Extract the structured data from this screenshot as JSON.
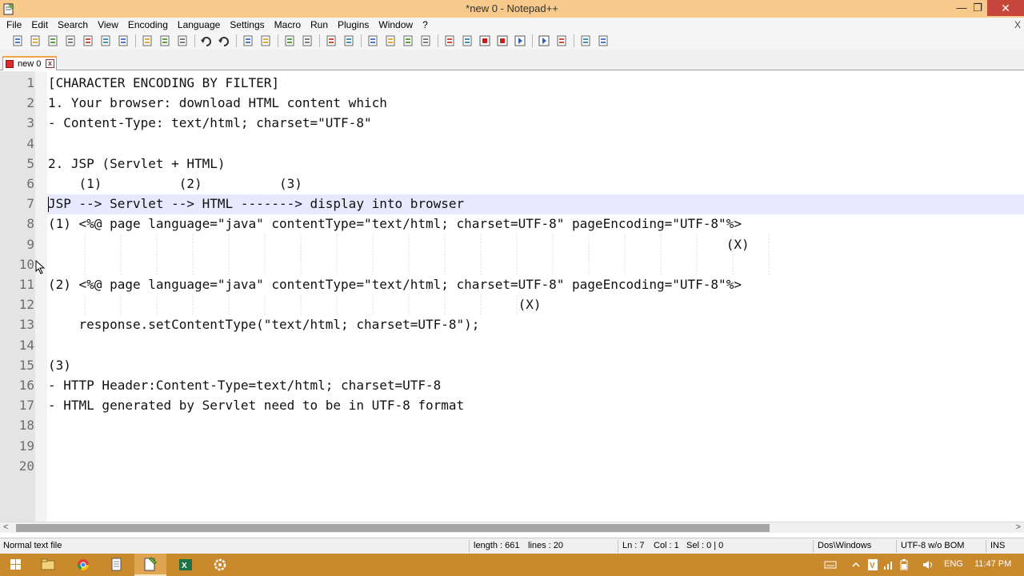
{
  "window": {
    "title": "*new  0 - Notepad++",
    "minimize_icon": "minimize-icon",
    "restore_icon": "restore-icon",
    "close_icon": "close-icon",
    "minimize_glyph": "—",
    "restore_glyph": "❐",
    "close_glyph": "✕"
  },
  "menu": {
    "items": [
      "File",
      "Edit",
      "Search",
      "View",
      "Encoding",
      "Language",
      "Settings",
      "Macro",
      "Run",
      "Plugins",
      "Window",
      "?"
    ],
    "close_glyph": "X"
  },
  "toolbar": {
    "buttons": [
      "new-file-icon",
      "open-file-icon",
      "save-icon",
      "save-all-icon",
      "close-icon",
      "close-all-icon",
      "print-icon",
      "cut-icon",
      "copy-icon",
      "paste-icon",
      "undo-icon",
      "redo-icon",
      "find-icon",
      "replace-icon",
      "zoom-in-icon",
      "zoom-out-icon",
      "sync-vertical-icon",
      "sync-horizontal-icon",
      "word-wrap-icon",
      "show-all-chars-icon",
      "indent-guide-icon",
      "user-language-icon",
      "doc-map-icon",
      "function-list-icon",
      "record-macro-icon",
      "stop-record-icon",
      "play-macro-icon",
      "run-macro-multiple-icon",
      "save-macro-icon",
      "spell-check-icon",
      "spell-check-options-icon"
    ]
  },
  "tabs": [
    {
      "label": "new  0",
      "icon": "unsaved-file-icon"
    }
  ],
  "editor": {
    "current_line": 7,
    "lines": [
      {
        "num": "1",
        "text": "[CHARACTER ENCODING BY FILTER]"
      },
      {
        "num": "2",
        "text": "1. Your browser: download HTML content which"
      },
      {
        "num": "3",
        "text": "- Content-Type: text/html; charset=\"UTF-8\""
      },
      {
        "num": "4",
        "text": ""
      },
      {
        "num": "5",
        "text": "2. JSP (Servlet + HTML)"
      },
      {
        "num": "6",
        "text": "    (1)          (2)          (3)"
      },
      {
        "num": "7",
        "text": "JSP --> Servlet --> HTML -------> display into browser"
      },
      {
        "num": "8",
        "text": "(1) <%@ page language=\"java\" contentType=\"text/html; charset=UTF-8\" pageEncoding=\"UTF-8\"%>"
      },
      {
        "num": "9",
        "text": "                                                                                        (X)"
      },
      {
        "num": "10",
        "text": ""
      },
      {
        "num": "11",
        "text": "(2) <%@ page language=\"java\" contentType=\"text/html; charset=UTF-8\" pageEncoding=\"UTF-8\"%>"
      },
      {
        "num": "12",
        "text": "                                                             (X)"
      },
      {
        "num": "13",
        "text": "    response.setContentType(\"text/html; charset=UTF-8\");"
      },
      {
        "num": "14",
        "text": ""
      },
      {
        "num": "15",
        "text": "(3)"
      },
      {
        "num": "16",
        "text": "- HTTP Header:Content-Type=text/html; charset=UTF-8"
      },
      {
        "num": "17",
        "text": "- HTML generated by Servlet need to be in UTF-8 format"
      },
      {
        "num": "18",
        "text": ""
      },
      {
        "num": "19",
        "text": ""
      },
      {
        "num": "20",
        "text": ""
      }
    ]
  },
  "scrollbar": {
    "left_arrow": "<",
    "right_arrow": ">"
  },
  "status": {
    "file_type": "Normal text file",
    "length": "length : 661",
    "lines": "lines : 20",
    "ln": "Ln : 7",
    "col": "Col : 1",
    "sel": "Sel : 0 | 0",
    "eol": "Dos\\Windows",
    "encoding": "UTF-8 w/o BOM",
    "mode": "INS"
  },
  "taskbar": {
    "apps": [
      "windows-start-icon",
      "file-explorer-icon",
      "chrome-icon",
      "notepad-icon",
      "notepad-plus-plus-icon",
      "excel-icon",
      "settings-icon"
    ],
    "active_app": "notepad-plus-plus-icon",
    "tray": {
      "language": "ENG",
      "time": "11:47 PM"
    },
    "tray_icons": [
      "keyboard-icon",
      "show-hidden-icons-icon",
      "antivirus-icon",
      "network-icon",
      "battery-icon",
      "volume-icon"
    ]
  }
}
